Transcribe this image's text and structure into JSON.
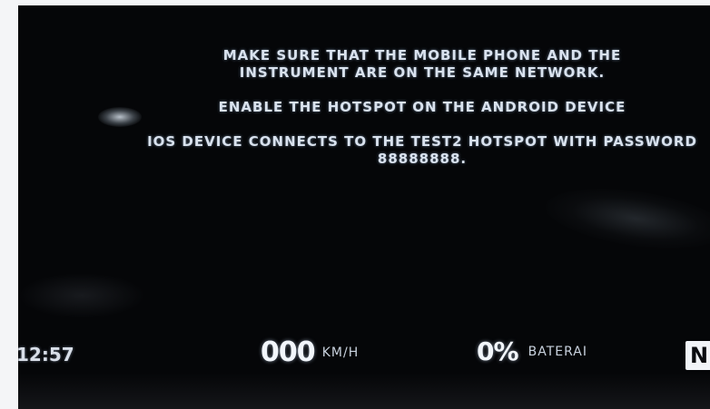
{
  "screen": {
    "messages": {
      "line1": "MAKE SURE THAT THE MOBILE PHONE AND THE INSTRUMENT ARE ON THE SAME NETWORK.",
      "line2": "ENABLE THE HOTSPOT ON THE ANDROID DEVICE",
      "line3": "IOS DEVICE CONNECTS TO THE TEST2 HOTSPOT WITH PASSWORD 88888888."
    }
  },
  "status_bar": {
    "clock": "12:57",
    "speed_value": "000",
    "speed_unit": "KM/H",
    "battery_value": "0%",
    "battery_label": "BATERAI",
    "gear": "N"
  }
}
